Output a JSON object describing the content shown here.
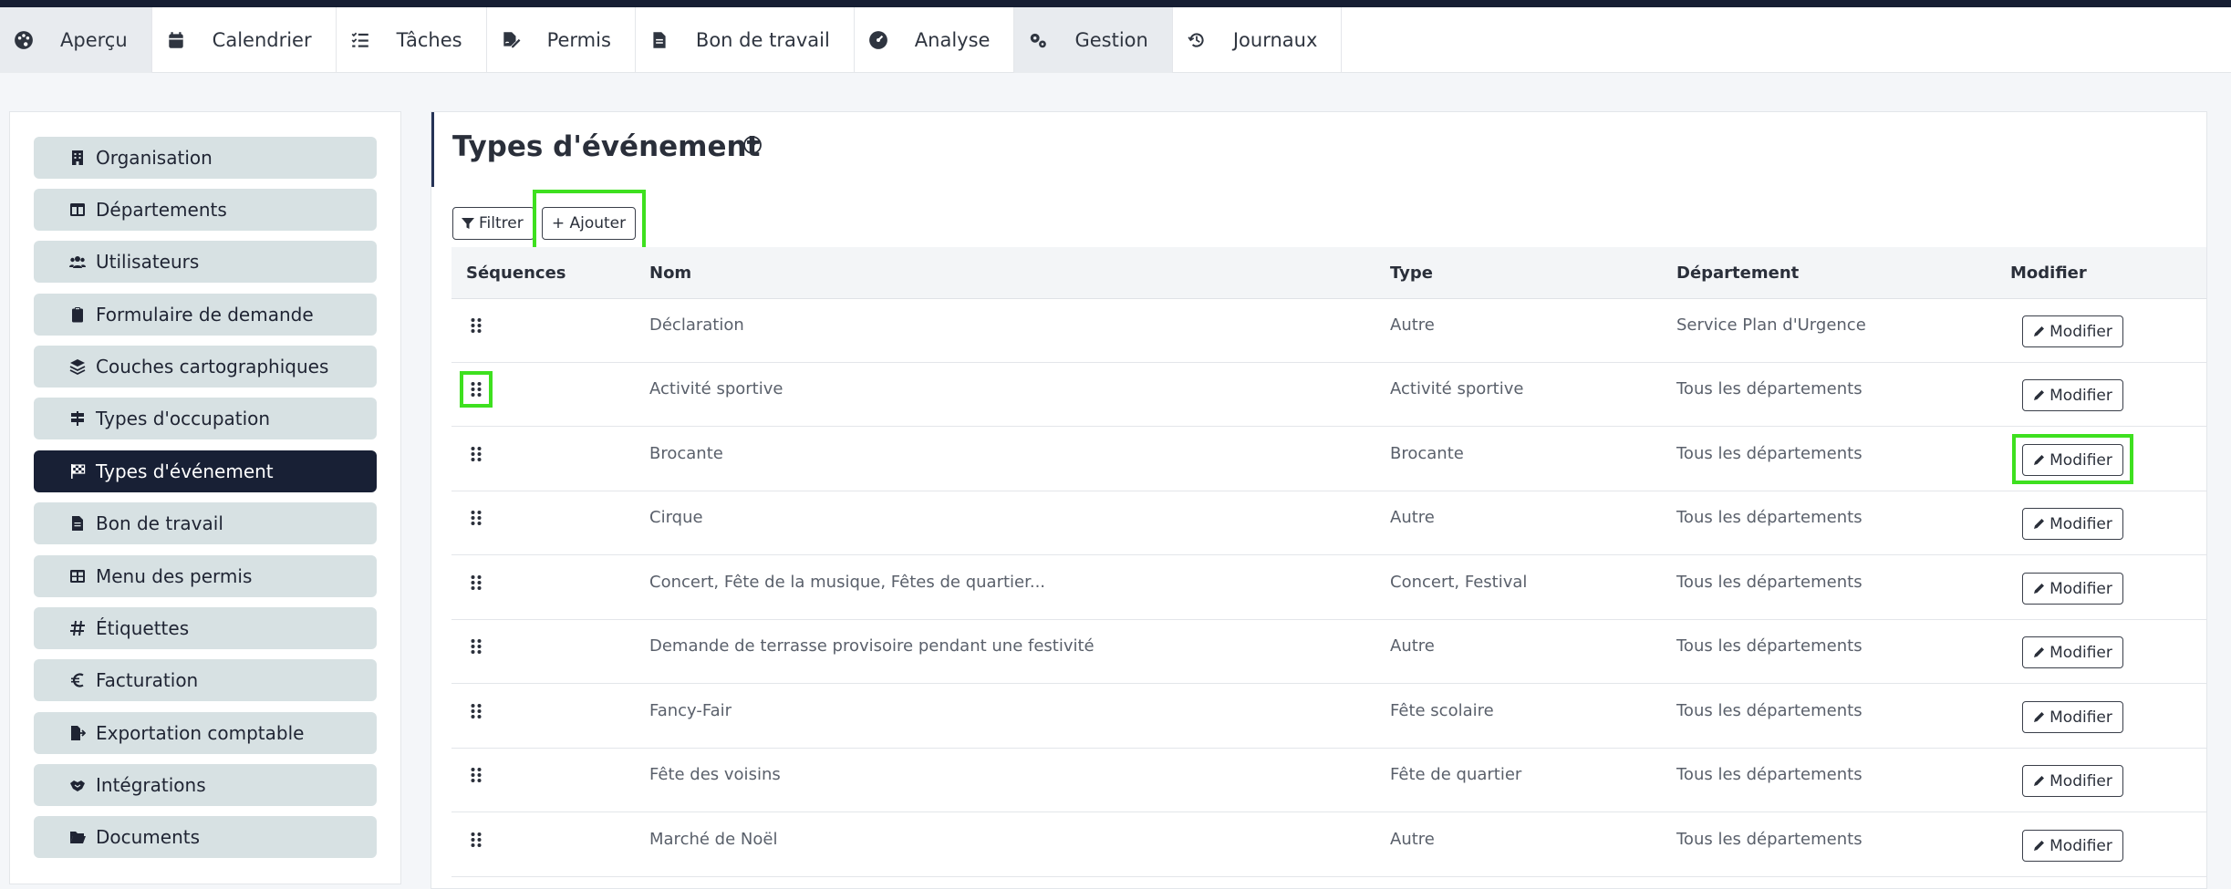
{
  "nav": {
    "tabs": [
      {
        "label": "Aperçu",
        "icon": "palette-icon",
        "active": true
      },
      {
        "label": "Calendrier",
        "icon": "calendar-icon",
        "active": false
      },
      {
        "label": "Tâches",
        "icon": "tasks-icon",
        "active": false
      },
      {
        "label": "Permis",
        "icon": "file-signature-icon",
        "active": false
      },
      {
        "label": "Bon de travail",
        "icon": "file-icon",
        "active": false
      },
      {
        "label": "Analyse",
        "icon": "gauge-icon",
        "active": false
      },
      {
        "label": "Gestion",
        "icon": "cogs-icon",
        "active": true
      },
      {
        "label": "Journaux",
        "icon": "history-icon",
        "active": false
      }
    ]
  },
  "sidebar": {
    "items": [
      {
        "label": "Organisation",
        "icon": "building-icon"
      },
      {
        "label": "Départements",
        "icon": "table-icon"
      },
      {
        "label": "Utilisateurs",
        "icon": "users-icon"
      },
      {
        "label": "Formulaire de demande",
        "icon": "clipboard-icon"
      },
      {
        "label": "Couches cartographiques",
        "icon": "layers-icon"
      },
      {
        "label": "Types d'occupation",
        "icon": "signs-icon"
      },
      {
        "label": "Types d'événement",
        "icon": "flag-checkered-icon",
        "active": true
      },
      {
        "label": "Bon de travail",
        "icon": "file-icon"
      },
      {
        "label": "Menu des permis",
        "icon": "grid-icon"
      },
      {
        "label": "Étiquettes",
        "icon": "hashtag-icon"
      },
      {
        "label": "Facturation",
        "icon": "euro-icon"
      },
      {
        "label": "Exportation comptable",
        "icon": "file-export-icon"
      },
      {
        "label": "Intégrations",
        "icon": "handshake-icon"
      },
      {
        "label": "Documents",
        "icon": "folder-open-icon"
      }
    ]
  },
  "main": {
    "title": "Types d'événement",
    "filter_label": "Filtrer",
    "add_label": "+ Ajouter",
    "columns": [
      "Séquences",
      "Nom",
      "Type",
      "Département",
      "Modifier"
    ],
    "edit_label": "Modifier",
    "rows": [
      {
        "nom": "Déclaration",
        "type": "Autre",
        "departement": "Service Plan d'Urgence"
      },
      {
        "nom": "Activité sportive",
        "type": "Activité sportive",
        "departement": "Tous les départements"
      },
      {
        "nom": "Brocante",
        "type": "Brocante",
        "departement": "Tous les départements"
      },
      {
        "nom": "Cirque",
        "type": "Autre",
        "departement": "Tous les départements"
      },
      {
        "nom": "Concert, Fête de la musique, Fêtes de quartier...",
        "type": "Concert, Festival",
        "departement": "Tous les départements"
      },
      {
        "nom": "Demande de terrasse provisoire pendant une festivité",
        "type": "Autre",
        "departement": "Tous les départements"
      },
      {
        "nom": "Fancy-Fair",
        "type": "Fête scolaire",
        "departement": "Tous les départements"
      },
      {
        "nom": "Fête des voisins",
        "type": "Fête de quartier",
        "departement": "Tous les départements"
      },
      {
        "nom": "Marché de Noël",
        "type": "Autre",
        "departement": "Tous les départements"
      }
    ]
  },
  "colors": {
    "highlight": "#3ee01f",
    "active_sidebar": "#182035",
    "sidebar_item": "#d7e1e3",
    "topbar": "#161e33"
  }
}
